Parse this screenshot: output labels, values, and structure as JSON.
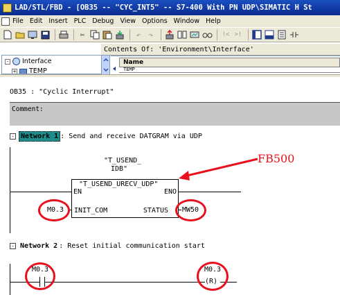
{
  "window": {
    "title": "LAD/STL/FBD  - [OB35 -- \"CYC_INT5\" -- S7-400 With PN UDP\\SIMATIC H St"
  },
  "menu": [
    "File",
    "Edit",
    "Insert",
    "PLC",
    "Debug",
    "View",
    "Options",
    "Window",
    "Help"
  ],
  "toolbar": {
    "icons": [
      "new-icon",
      "open-icon",
      "online-icon",
      "save-icon",
      "print-icon",
      "cut-icon",
      "copy-icon",
      "paste-icon",
      "download-icon",
      "undo-icon",
      "redo-icon",
      "upload-icon",
      "compare-icon",
      "monitor-icon",
      "glasses-icon",
      "network-prev-icon",
      "network-next-icon",
      "overview-icon",
      "details-icon",
      "catalog-icon",
      "contact-icon"
    ]
  },
  "interface_panel": {
    "contents_of": "Contents Of: 'Environment\\Interface'",
    "tree": [
      {
        "label": "Interface",
        "toggle": "-"
      },
      {
        "label": "TEMP",
        "toggle": "+"
      }
    ],
    "column_header": "Name",
    "first_row": "TEMP"
  },
  "editor": {
    "block_title": "OB35 :  \"Cyclic Interrupt\"",
    "comment_label": "Comment:",
    "networks": [
      {
        "toggle": "-",
        "label": "Network 1",
        "description": ": Send and receive DATGRAM via UDP",
        "instance_db": [
          "\"T_USEND_",
          "IDB\""
        ],
        "block_name": "\"T_USEND_URECV_UDP\"",
        "en": "EN",
        "eno": "ENO",
        "input_name": "INIT_COM",
        "input_operand": "M0.3",
        "output_name": "STATUS",
        "output_operand": "MW50"
      },
      {
        "toggle": "-",
        "label": "Network 2",
        "description": ": Reset initial communication start",
        "contact_operand": "M0.3",
        "coil_operand": "M0.3",
        "coil_symbol": "(R)"
      }
    ]
  },
  "annotation": {
    "fb_label": "FB500",
    "color": "#e8101c"
  }
}
